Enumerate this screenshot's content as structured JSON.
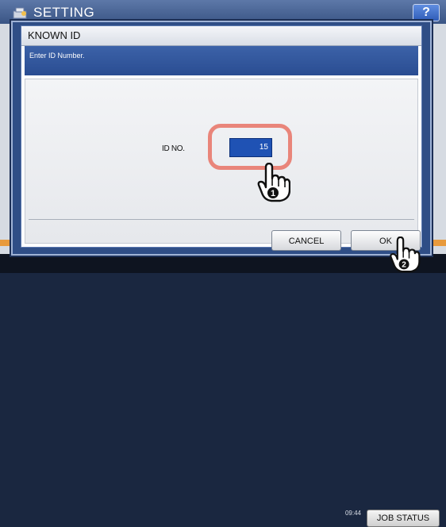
{
  "background": {
    "title": "SETTING",
    "help_label": "?",
    "time": "09:44",
    "job_label": "JOB STATUS"
  },
  "dialog": {
    "title": "KNOWN ID",
    "message": "Enter ID Number.",
    "id_label": "ID NO.",
    "id_value": "15",
    "cancel_label": "CANCEL",
    "ok_label": "OK"
  },
  "annotations": {
    "step1": "1",
    "step2": "2"
  },
  "colors": {
    "highlight": "#e9857a",
    "field_bg": "#1f52b4",
    "band": "#2a4d92"
  }
}
